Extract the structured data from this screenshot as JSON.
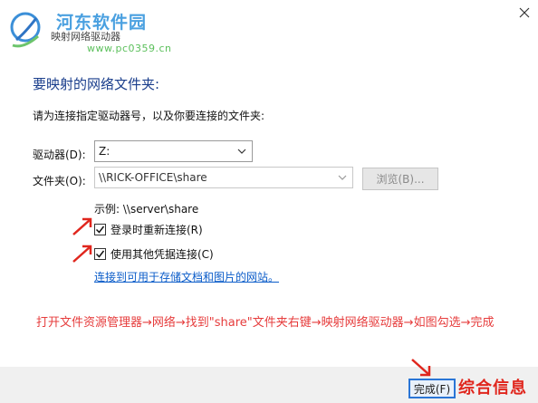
{
  "watermark": {
    "site_name": "河东软件园",
    "site_url": "www.pc0359.cn",
    "corner_text": "综合信息"
  },
  "window": {
    "title": "映射网络驱动器"
  },
  "dialog": {
    "heading": "要映射的网络文件夹:",
    "instruction": "请为连接指定驱动器号，以及你要连接的文件夹:",
    "drive_label": "驱动器(D):",
    "drive_value": "Z:",
    "folder_label": "文件夹(O):",
    "folder_value": "\\\\RICK-OFFICE\\share",
    "browse_label": "浏览(B)...",
    "example": "示例: \\\\server\\share",
    "reconnect_label": "登录时重新连接(R)",
    "reconnect_checked": true,
    "credentials_label": "使用其他凭据连接(C)",
    "credentials_checked": true,
    "link_text": "连接到可用于存储文档和图片的网站。",
    "annotation": "打开文件资源管理器→网络→找到\"share\"文件夹右键→映射网络驱动器→如图勾选→完成",
    "finish_label": "完成(F)"
  },
  "colors": {
    "heading": "#1a3e8c",
    "annotation": "#e63c3c",
    "link": "#0b5cc9",
    "finish_border": "#2a75d6"
  },
  "icons": {
    "logo": "site-logo",
    "close": "close-icon",
    "dropdown": "chevron-down-icon",
    "check": "check-icon",
    "arrow": "red-arrow-icon"
  }
}
